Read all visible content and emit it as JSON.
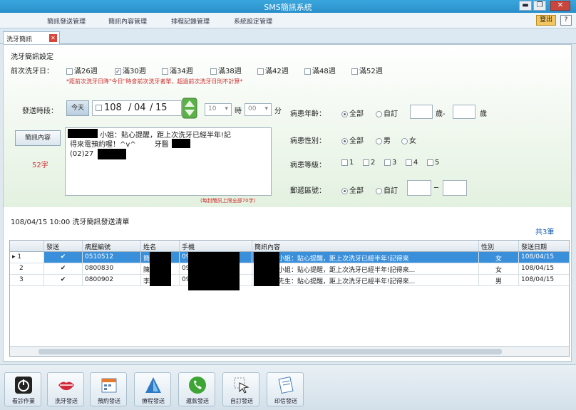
{
  "window": {
    "title": "SMS簡訊系統",
    "min_btn": "▬",
    "max_btn": "❐",
    "close_btn": "✕"
  },
  "menubar": {
    "items": [
      "簡訊發送管理",
      "簡訊內容管理",
      "排程記錄管理",
      "系統設定管理"
    ],
    "exit_label": "登出",
    "help_label": "?"
  },
  "tab": {
    "label": "洗牙簡訊",
    "close": "✕"
  },
  "form": {
    "section_title": "洗牙簡訊設定",
    "last_wash_label": "前次洗牙日：",
    "week_options": [
      {
        "label": "滿26週",
        "checked": false
      },
      {
        "label": "滿30週",
        "checked": true
      },
      {
        "label": "滿34週",
        "checked": false
      },
      {
        "label": "滿38週",
        "checked": false
      },
      {
        "label": "滿42週",
        "checked": false
      },
      {
        "label": "滿48週",
        "checked": false
      },
      {
        "label": "滿52週",
        "checked": false
      }
    ],
    "week_note": "*距前次洗牙日降\"今日\"時會前次洗牙者單，超過前次洗牙日則不計算*",
    "send_time_label": "發送時段：",
    "today_btn": "今天",
    "date_year": "108",
    "date_month": "04",
    "date_day": "15",
    "hour_value": "10",
    "hour_unit": "時",
    "minute_value": "00",
    "minute_unit": "分",
    "sms_content_btn": "簡訊內容",
    "char_count": "52字",
    "sms_text_line1": "小姐：貼心提醒，距上次洗牙已經半年!記",
    "sms_text_line2": "得來電預約喔！^v^",
    "sms_text_line2b": "牙醫",
    "sms_text_line3": "(02)27",
    "sms_limit_note": "(每封簡訊上限全部70字)",
    "age_label": "病患年齡：",
    "age_all": "全部",
    "age_custom": "自訂",
    "age_unit1": "歲-",
    "age_unit2": "歲",
    "gender_label": "病患性別：",
    "gender_all": "全部",
    "gender_male": "男",
    "gender_female": "女",
    "level_label": "病患等級：",
    "levels": [
      "1",
      "2",
      "3",
      "4",
      "5"
    ],
    "zip_label": "郵遞區號：",
    "zip_all": "全部",
    "zip_custom": "自訂",
    "zip_dash": "─"
  },
  "list": {
    "title": "108/04/15 10:00 洗牙簡訊發送清單",
    "count": "共3筆",
    "columns": [
      "發送",
      "病歷編號",
      "姓名",
      "手機",
      "簡訊內容",
      "性別",
      "發送日期"
    ],
    "rows": [
      {
        "num": "1",
        "send": "✔",
        "chart_no": "0510512",
        "name": "簡",
        "phone": "09",
        "content": "小姐：貼心提醒，距上次洗牙已經半年!記得來",
        "gender": "女",
        "date": "108/04/15"
      },
      {
        "num": "2",
        "send": "✔",
        "chart_no": "0800830",
        "name": "陳",
        "phone": "09",
        "content": "小姐：貼心提醒，距上次洗牙已經半年!記得來...",
        "gender": "女",
        "date": "108/04/15"
      },
      {
        "num": "3",
        "send": "✔",
        "chart_no": "0800902",
        "name": "李",
        "phone": "09",
        "content": "先生：貼心提醒，距上次洗牙已經半年!記得來...",
        "gender": "男",
        "date": "108/04/15"
      }
    ]
  },
  "toolbar": {
    "buttons": [
      {
        "label": "看診作業",
        "icon": "power-icon"
      },
      {
        "label": "洗牙發送",
        "icon": "lips-icon"
      },
      {
        "label": "預約發送",
        "icon": "calendar-icon"
      },
      {
        "label": "療程發送",
        "icon": "tooth-icon"
      },
      {
        "label": "還款發送",
        "icon": "phone-icon"
      },
      {
        "label": "自訂發送",
        "icon": "cursor-icon"
      },
      {
        "label": "印信發送",
        "icon": "document-icon"
      }
    ]
  }
}
